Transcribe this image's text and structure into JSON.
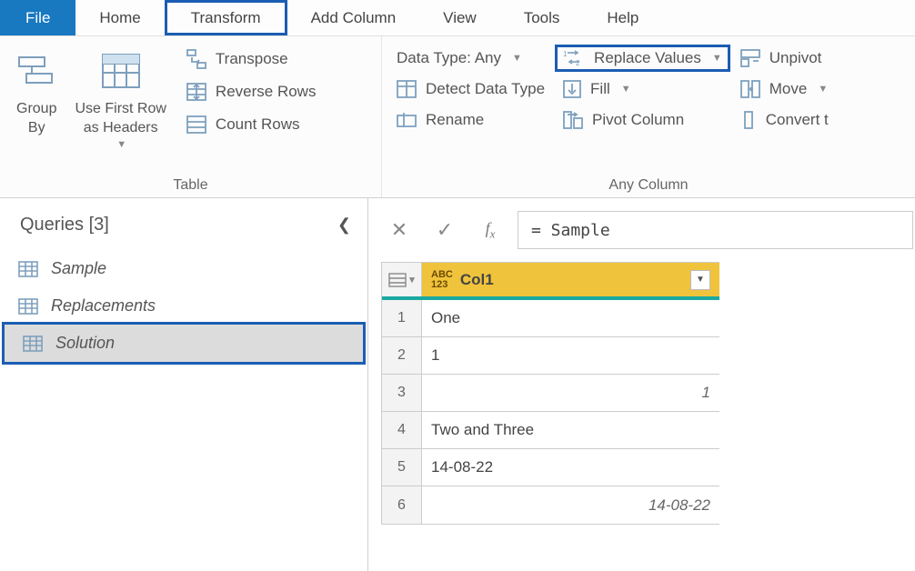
{
  "menu": {
    "file": "File",
    "home": "Home",
    "transform": "Transform",
    "addColumn": "Add Column",
    "view": "View",
    "tools": "Tools",
    "help": "Help"
  },
  "ribbon": {
    "tableGroup": {
      "label": "Table",
      "groupBy": "Group\nBy",
      "useFirstRow": "Use First Row\nas Headers",
      "transpose": "Transpose",
      "reverseRows": "Reverse Rows",
      "countRows": "Count Rows"
    },
    "anyColumnGroup": {
      "label": "Any Column",
      "dataType": "Data Type: Any",
      "detectDataType": "Detect Data Type",
      "rename": "Rename",
      "replaceValues": "Replace Values",
      "fill": "Fill",
      "pivotColumn": "Pivot Column",
      "unpivot": "Unpivot",
      "move": "Move",
      "convert": "Convert t"
    }
  },
  "queries": {
    "title": "Queries [3]",
    "items": [
      "Sample",
      "Replacements",
      "Solution"
    ],
    "selectedIndex": 2
  },
  "formula": {
    "value": "= Sample"
  },
  "grid": {
    "column": {
      "typeBadge": "ABC\n123",
      "name": "Col1"
    },
    "rows": [
      {
        "n": "1",
        "value": "One",
        "align": "left"
      },
      {
        "n": "2",
        "value": "1",
        "align": "left"
      },
      {
        "n": "3",
        "value": "1",
        "align": "right"
      },
      {
        "n": "4",
        "value": "Two and Three",
        "align": "left"
      },
      {
        "n": "5",
        "value": "14-08-22",
        "align": "left"
      },
      {
        "n": "6",
        "value": "14-08-22",
        "align": "right"
      }
    ]
  }
}
